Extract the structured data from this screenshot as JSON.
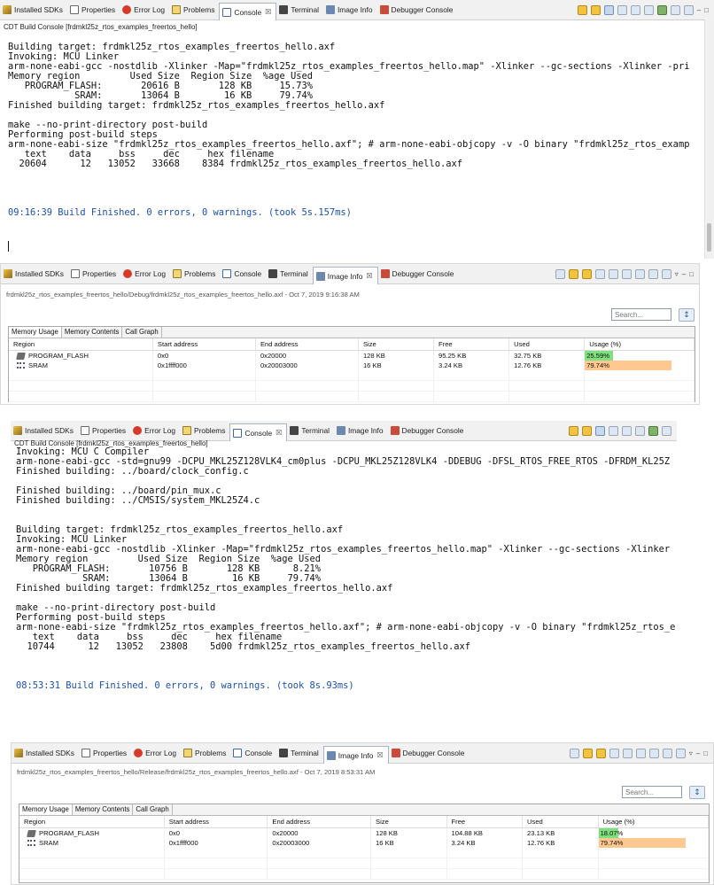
{
  "colors": {
    "usage_low": "#7ee07e",
    "usage_high": "#ffc890",
    "link_blue": "#1a4fb5"
  },
  "panels": [
    {
      "type": "console",
      "tabs": [
        {
          "label": "Installed SDKs",
          "icon": "sdk-icon"
        },
        {
          "label": "Properties",
          "icon": "properties-icon"
        },
        {
          "label": "Error Log",
          "icon": "error-log-icon"
        },
        {
          "label": "Problems",
          "icon": "problems-icon"
        },
        {
          "label": "Console",
          "icon": "console-icon",
          "active": true
        },
        {
          "label": "Terminal",
          "icon": "terminal-icon"
        },
        {
          "label": "Image Info",
          "icon": "image-info-icon"
        },
        {
          "label": "Debugger Console",
          "icon": "debugger-console-icon"
        }
      ],
      "subtitle": "CDT Build Console [frdmkl25z_rtos_examples_freertos_hello]",
      "lines": [
        "Building target: frdmkl25z_rtos_examples_freertos_hello.axf",
        "Invoking: MCU Linker",
        "arm-none-eabi-gcc -nostdlib -Xlinker -Map=\"frdmkl25z_rtos_examples_freertos_hello.map\" -Xlinker --gc-sections -Xlinker -pri",
        "Memory region         Used Size  Region Size  %age Used",
        "   PROGRAM_FLASH:       20616 B       128 KB     15.73%",
        "            SRAM:       13064 B        16 KB     79.74%",
        "Finished building target: frdmkl25z_rtos_examples_freertos_hello.axf",
        "",
        "make --no-print-directory post-build",
        "Performing post-build steps",
        "arm-none-eabi-size \"frdmkl25z_rtos_examples_freertos_hello.axf\"; # arm-none-eabi-objcopy -v -O binary \"frdmkl25z_rtos_examp",
        "   text    data     bss     dec     hex filename",
        "  20604      12   13052   33668    8384 frdmkl25z_rtos_examples_freertos_hello.axf",
        "",
        "",
        ""
      ],
      "finished": "09:16:39 Build Finished. 0 errors, 0 warnings. (took 5s.157ms)"
    },
    {
      "type": "image_info",
      "tabs": [
        {
          "label": "Installed SDKs",
          "icon": "sdk-icon"
        },
        {
          "label": "Properties",
          "icon": "properties-icon"
        },
        {
          "label": "Error Log",
          "icon": "error-log-icon"
        },
        {
          "label": "Problems",
          "icon": "problems-icon"
        },
        {
          "label": "Console",
          "icon": "console-icon"
        },
        {
          "label": "Terminal",
          "icon": "terminal-icon"
        },
        {
          "label": "Image Info",
          "icon": "image-info-icon",
          "active": true
        },
        {
          "label": "Debugger Console",
          "icon": "debugger-console-icon"
        }
      ],
      "path": "frdmkl25z_rtos_examples_freertos_hello/Debug/frdmkl25z_rtos_examples_freertos_hello.axf - Oct 7, 2019 9:16:38 AM",
      "search_placeholder": "Search...",
      "subtabs": [
        "Memory Usage",
        "Memory Contents",
        "Call Graph"
      ],
      "columns": [
        "Region",
        "Start address",
        "End address",
        "Size",
        "Free",
        "Used",
        "Usage (%)"
      ],
      "rows": [
        {
          "region": "PROGRAM_FLASH",
          "icon": "flash-memory-icon",
          "start": "0x0",
          "end": "0x20000",
          "size": "128 KB",
          "free": "95.25 KB",
          "used": "32.75 KB",
          "usage": "25.59%",
          "usage_value": 25.59,
          "usage_color": "#7ee07e"
        },
        {
          "region": "SRAM",
          "icon": "sram-memory-icon",
          "start": "0x1ffff000",
          "end": "0x20003000",
          "size": "16 KB",
          "free": "3.24 KB",
          "used": "12.76 KB",
          "usage": "79.74%",
          "usage_value": 79.74,
          "usage_color": "#ffc890"
        }
      ]
    },
    {
      "type": "console",
      "tabs": [
        {
          "label": "Installed SDKs",
          "icon": "sdk-icon"
        },
        {
          "label": "Properties",
          "icon": "properties-icon"
        },
        {
          "label": "Error Log",
          "icon": "error-log-icon"
        },
        {
          "label": "Problems",
          "icon": "problems-icon"
        },
        {
          "label": "Console",
          "icon": "console-icon",
          "active": true
        },
        {
          "label": "Terminal",
          "icon": "terminal-icon"
        },
        {
          "label": "Image Info",
          "icon": "image-info-icon"
        },
        {
          "label": "Debugger Console",
          "icon": "debugger-console-icon"
        }
      ],
      "subtitle": "CDT Build Console [frdmkl25z_rtos_examples_freertos_hello]",
      "lines": [
        "Invoking: MCU C Compiler",
        "arm-none-eabi-gcc -std=gnu99 -DCPU_MKL25Z128VLK4_cm0plus -DCPU_MKL25Z128VLK4 -DDEBUG -DFSL_RTOS_FREE_RTOS -DFRDM_KL25Z",
        "Finished building: ../board/clock_config.c",
        "",
        "Finished building: ../board/pin_mux.c",
        "Finished building: ../CMSIS/system_MKL25Z4.c",
        "",
        "",
        "Building target: frdmkl25z_rtos_examples_freertos_hello.axf",
        "Invoking: MCU Linker",
        "arm-none-eabi-gcc -nostdlib -Xlinker -Map=\"frdmkl25z_rtos_examples_freertos_hello.map\" -Xlinker --gc-sections -Xlinker",
        "Memory region         Used Size  Region Size  %age Used",
        "   PROGRAM_FLASH:       10756 B       128 KB      8.21%",
        "            SRAM:       13064 B        16 KB     79.74%",
        "Finished building target: frdmkl25z_rtos_examples_freertos_hello.axf",
        "",
        "make --no-print-directory post-build",
        "Performing post-build steps",
        "arm-none-eabi-size \"frdmkl25z_rtos_examples_freertos_hello.axf\"; # arm-none-eabi-objcopy -v -O binary \"frdmkl25z_rtos_e",
        "   text    data     bss     dec     hex filename",
        "  10744      12   13052   23808    5d00 frdmkl25z_rtos_examples_freertos_hello.axf",
        "",
        ""
      ],
      "finished": "08:53:31 Build Finished. 0 errors, 0 warnings. (took 8s.93ms)"
    },
    {
      "type": "image_info",
      "tabs": [
        {
          "label": "Installed SDKs",
          "icon": "sdk-icon"
        },
        {
          "label": "Properties",
          "icon": "properties-icon"
        },
        {
          "label": "Error Log",
          "icon": "error-log-icon"
        },
        {
          "label": "Problems",
          "icon": "problems-icon"
        },
        {
          "label": "Console",
          "icon": "console-icon"
        },
        {
          "label": "Terminal",
          "icon": "terminal-icon"
        },
        {
          "label": "Image Info",
          "icon": "image-info-icon",
          "active": true
        },
        {
          "label": "Debugger Console",
          "icon": "debugger-console-icon"
        }
      ],
      "path": "frdmkl25z_rtos_examples_freertos_hello/Release/frdmkl25z_rtos_examples_freertos_hello.axf - Oct 7, 2019 8:53:31 AM",
      "search_placeholder": "Search...",
      "subtabs": [
        "Memory Usage",
        "Memory Contents",
        "Call Graph"
      ],
      "columns": [
        "Region",
        "Start address",
        "End address",
        "Size",
        "Free",
        "Used",
        "Usage (%)"
      ],
      "rows": [
        {
          "region": "PROGRAM_FLASH",
          "icon": "flash-memory-icon",
          "start": "0x0",
          "end": "0x20000",
          "size": "128 KB",
          "free": "104.88 KB",
          "used": "23.13 KB",
          "usage": "18.07%",
          "usage_value": 18.07,
          "usage_color": "#7ee07e"
        },
        {
          "region": "SRAM",
          "icon": "sram-memory-icon",
          "start": "0x1ffff000",
          "end": "0x20003000",
          "size": "16 KB",
          "free": "3.24 KB",
          "used": "12.76 KB",
          "usage": "79.74%",
          "usage_value": 79.74,
          "usage_color": "#ffc890"
        }
      ]
    }
  ]
}
